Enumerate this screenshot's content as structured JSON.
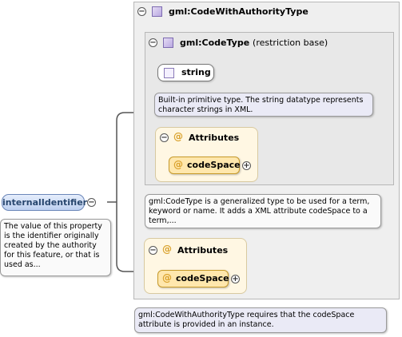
{
  "outer_type": {
    "title": "gml:CodeWithAuthorityType",
    "toggle": "⊖",
    "note": "gml:CodeWithAuthorityType requires that the codeSpace attribute is provided in an instance."
  },
  "inner_type": {
    "title": "gml:CodeType",
    "title_suffix": "(restriction base)",
    "toggle": "⊖",
    "note": "gml:CodeType is a generalized type to be used for a term, keyword or name. It adds a XML attribute codeSpace to a term,..."
  },
  "string_type": {
    "label": "string",
    "note": "Built-in primitive type. The string datatype represents character strings in XML."
  },
  "inner_attributes": {
    "toggle": "⊖",
    "at_symbol": "@",
    "label": "Attributes",
    "item": {
      "at_symbol": "@",
      "label": "codeSpace",
      "expand": "+"
    }
  },
  "outer_attributes": {
    "toggle": "⊖",
    "at_symbol": "@",
    "label": "Attributes",
    "item": {
      "at_symbol": "@",
      "label": "codeSpace",
      "expand": "+"
    }
  },
  "element": {
    "label": "internalIdentifier",
    "toggle": "⊖",
    "note": "The value of this property is the identifier originally created by the authority for this feature, or that is used as..."
  }
}
